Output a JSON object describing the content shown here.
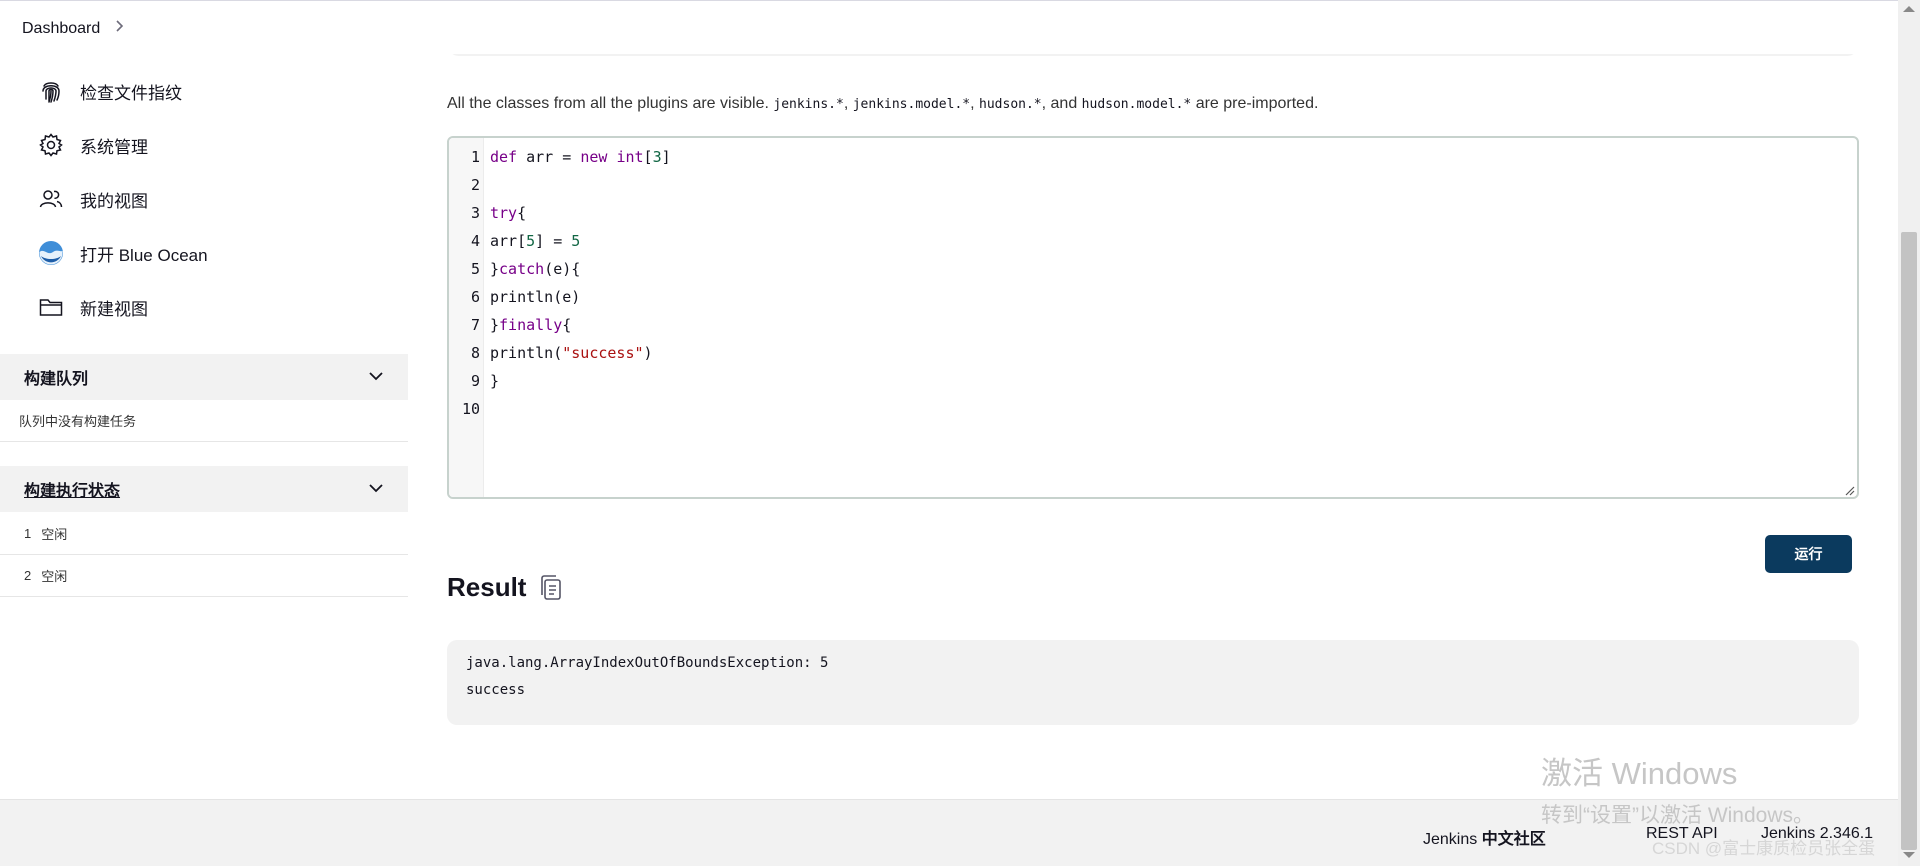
{
  "breadcrumb": {
    "items": [
      "Dashboard"
    ]
  },
  "sidebar": {
    "tasks": [
      {
        "label": "检查文件指纹",
        "icon": "fingerprint-icon"
      },
      {
        "label": "系统管理",
        "icon": "gear-icon"
      },
      {
        "label": "我的视图",
        "icon": "people-icon"
      },
      {
        "label": "打开 Blue Ocean",
        "icon": "blue-ocean-icon"
      },
      {
        "label": "新建视图",
        "icon": "folder-icon"
      }
    ],
    "build_queue": {
      "title": "构建队列",
      "empty_text": "队列中没有构建任务"
    },
    "executors": {
      "title": "构建执行状态",
      "rows": [
        {
          "number": "1",
          "status": "空闲"
        },
        {
          "number": "2",
          "status": "空闲"
        }
      ]
    }
  },
  "main": {
    "description_parts": [
      "All the classes from all the plugins are visible. ",
      "jenkins.*",
      ", ",
      "jenkins.model.*",
      ", ",
      "hudson.*",
      ", and ",
      "hudson.model.*",
      " are pre-imported."
    ],
    "editor": {
      "line_numbers": [
        "1",
        "2",
        "3",
        "4",
        "5",
        "6",
        "7",
        "8",
        "9",
        "10"
      ],
      "lines": [
        "def arr = new int[3]",
        "",
        "try{",
        "arr[5] = 5",
        "}catch(e){",
        "println(e)",
        "}finally{",
        "println(\"success\")",
        "}",
        ""
      ]
    },
    "run_button": "运行",
    "result": {
      "title": "Result",
      "output": [
        "java.lang.ArrayIndexOutOfBoundsException: 5",
        "success"
      ]
    }
  },
  "footer": {
    "community_prefix": "Jenkins ",
    "community_bold": "中文社区",
    "rest_api": "REST API",
    "version": "Jenkins 2.346.1"
  },
  "overlay": {
    "activate_title": "激活 Windows",
    "activate_sub": "转到“设置”以激活 Windows。",
    "csdn": "CSDN @富士康质检员张全蛋"
  },
  "colors": {
    "primary_button": "#0b3a5e",
    "keyword": "#770088",
    "number": "#116644",
    "string": "#aa1111",
    "panel_bg": "#f2f2f2"
  }
}
